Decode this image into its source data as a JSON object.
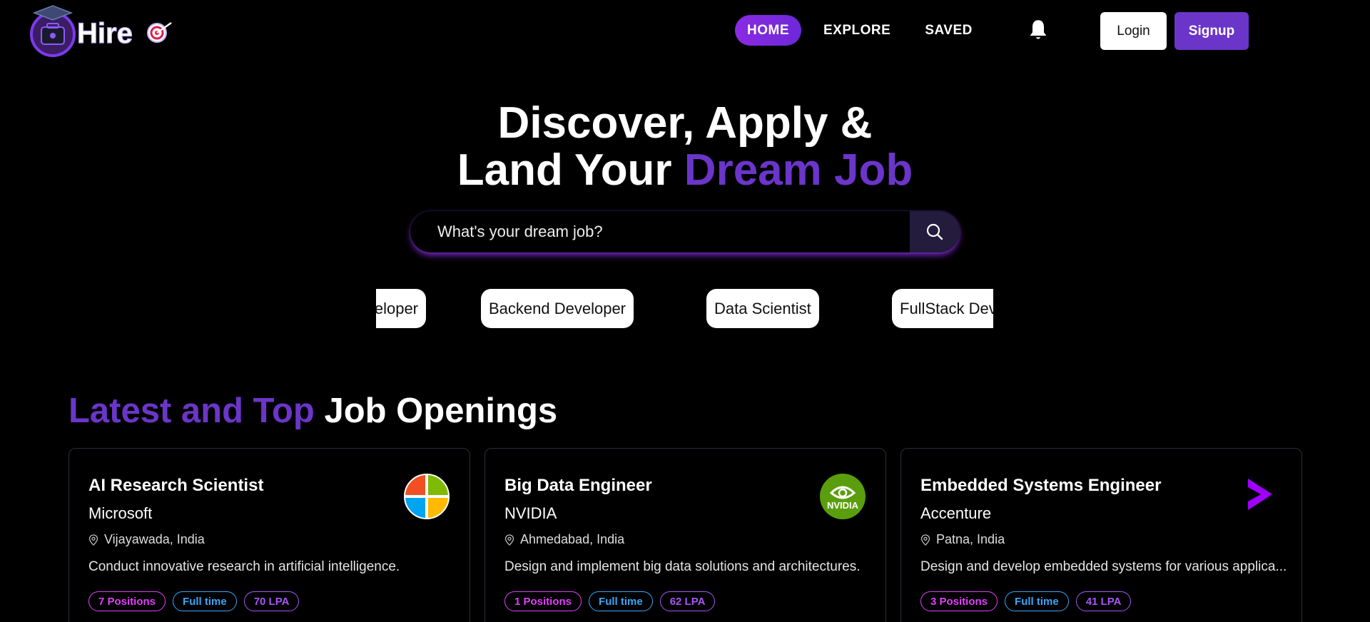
{
  "brand": {
    "name": "Hire",
    "accent_color": "#6b35c9"
  },
  "nav": {
    "items": [
      {
        "label": "HOME",
        "active": true
      },
      {
        "label": "EXPLORE",
        "active": false
      },
      {
        "label": "SAVED",
        "active": false
      }
    ],
    "bell_icon": "bell-icon",
    "login_label": "Login",
    "signup_label": "Signup"
  },
  "hero": {
    "line1": "Discover, Apply &",
    "line2_plain": "Land Your ",
    "line2_accent": "Dream Job"
  },
  "search": {
    "placeholder": "What's your dream job?",
    "icon": "search-icon"
  },
  "chips": [
    "eloper",
    "Backend Developer",
    "Data Scientist",
    "FullStack Dev"
  ],
  "section": {
    "title_accent": "Latest and Top",
    "title_plain": " Job Openings"
  },
  "jobs": [
    {
      "role": "AI Research Scientist",
      "company": "Microsoft",
      "location": "Vijayawada, India",
      "description": "Conduct innovative research in artificial intelligence.",
      "positions": "7 Positions",
      "type": "Full time",
      "salary": "70 LPA",
      "logo_icon": "microsoft-logo-icon"
    },
    {
      "role": "Big Data Engineer",
      "company": "NVIDIA",
      "location": "Ahmedabad, India",
      "description": "Design and implement big data solutions and architectures.",
      "positions": "1 Positions",
      "type": "Full time",
      "salary": "62 LPA",
      "logo_icon": "nvidia-logo-icon",
      "logo_text": "NVIDIA"
    },
    {
      "role": "Embedded Systems Engineer",
      "company": "Accenture",
      "location": "Patna, India",
      "description": "Design and develop embedded systems for various applica...",
      "positions": "3 Positions",
      "type": "Full time",
      "salary": "41 LPA",
      "logo_icon": "accenture-logo-icon"
    }
  ]
}
